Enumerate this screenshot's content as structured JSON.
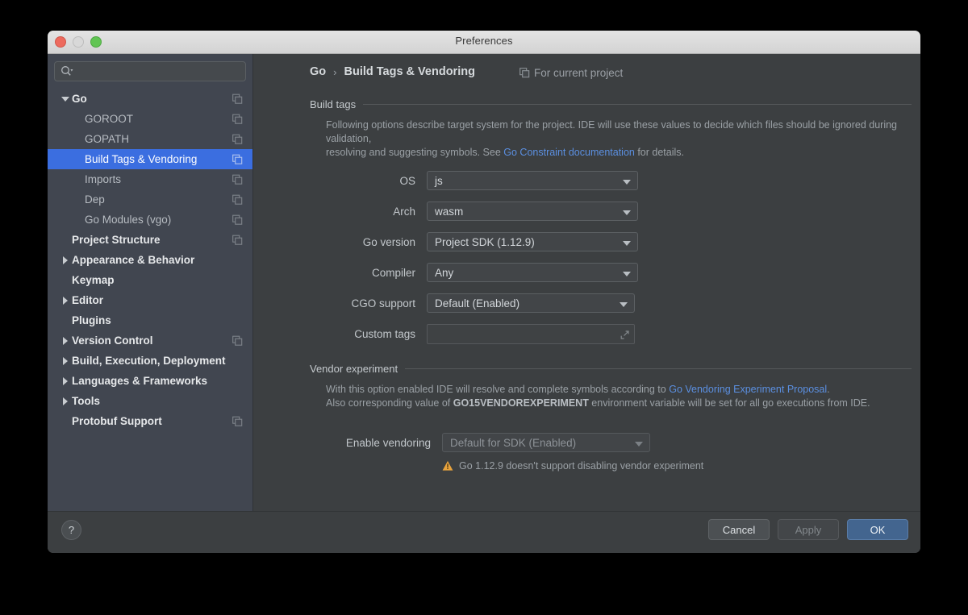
{
  "window": {
    "title": "Preferences",
    "traffic_lights": [
      "close-light",
      "minimize-light",
      "zoom-light"
    ]
  },
  "sidebar": {
    "search": {
      "placeholder": "",
      "value": "",
      "icon": "search-icon"
    },
    "items": [
      {
        "label": "Go",
        "level": "top",
        "twisty": "down",
        "copy": true,
        "selected": false
      },
      {
        "label": "GOROOT",
        "level": "child",
        "twisty": "none",
        "copy": true,
        "selected": false
      },
      {
        "label": "GOPATH",
        "level": "child",
        "twisty": "none",
        "copy": true,
        "selected": false
      },
      {
        "label": "Build Tags & Vendoring",
        "level": "child",
        "twisty": "none",
        "copy": true,
        "selected": true
      },
      {
        "label": "Imports",
        "level": "child",
        "twisty": "none",
        "copy": true,
        "selected": false
      },
      {
        "label": "Dep",
        "level": "child",
        "twisty": "none",
        "copy": true,
        "selected": false
      },
      {
        "label": "Go Modules (vgo)",
        "level": "child",
        "twisty": "none",
        "copy": true,
        "selected": false
      },
      {
        "label": "Project Structure",
        "level": "top",
        "twisty": "none",
        "copy": true,
        "selected": false
      },
      {
        "label": "Appearance & Behavior",
        "level": "top",
        "twisty": "right",
        "copy": false,
        "selected": false
      },
      {
        "label": "Keymap",
        "level": "top",
        "twisty": "none",
        "copy": false,
        "selected": false
      },
      {
        "label": "Editor",
        "level": "top",
        "twisty": "right",
        "copy": false,
        "selected": false
      },
      {
        "label": "Plugins",
        "level": "top",
        "twisty": "none",
        "copy": false,
        "selected": false
      },
      {
        "label": "Version Control",
        "level": "top",
        "twisty": "right",
        "copy": true,
        "selected": false
      },
      {
        "label": "Build, Execution, Deployment",
        "level": "top",
        "twisty": "right",
        "copy": false,
        "selected": false
      },
      {
        "label": "Languages & Frameworks",
        "level": "top",
        "twisty": "right",
        "copy": false,
        "selected": false
      },
      {
        "label": "Tools",
        "level": "top",
        "twisty": "right",
        "copy": false,
        "selected": false
      },
      {
        "label": "Protobuf Support",
        "level": "top",
        "twisty": "none",
        "copy": true,
        "selected": false
      }
    ]
  },
  "header": {
    "crumb_root": "Go",
    "crumb_sep": "›",
    "crumb_leaf": "Build Tags & Vendoring",
    "scope_label": "For current project",
    "scope_icon": "copy-icon"
  },
  "build_tags": {
    "section_title": "Build tags",
    "desc_line1": "Following options describe target system for the project. IDE will use these values to decide which files should be ignored during validation,",
    "desc_line2_pre": "resolving and suggesting symbols. See ",
    "desc_link": "Go Constraint documentation",
    "desc_line2_post": " for details.",
    "fields": {
      "os_label": "OS",
      "os_value": "js",
      "arch_label": "Arch",
      "arch_value": "wasm",
      "goversion_label": "Go version",
      "goversion_value": "Project SDK (1.12.9)",
      "compiler_label": "Compiler",
      "compiler_value": "Any",
      "cgo_label": "CGO support",
      "cgo_value": "Default (Enabled)",
      "customtags_label": "Custom tags",
      "customtags_value": "",
      "customtags_placeholder": ""
    }
  },
  "vendor_experiment": {
    "section_title": "Vendor experiment",
    "desc_line1_pre": "With this option enabled IDE will resolve and complete symbols according to ",
    "desc_link": "Go Vendoring Experiment Proposal",
    "desc_line1_post": ".",
    "desc_line2_pre": "Also corresponding value of ",
    "desc_line2_bold": "GO15VENDOREXPERIMENT",
    "desc_line2_post": " environment variable will be set for all go executions from IDE.",
    "enable_label": "Enable vendoring",
    "enable_value": "Default for SDK (Enabled)",
    "warning_text": "Go 1.12.9 doesn't support disabling vendor experiment",
    "warning_icon": "warning-triangle-icon"
  },
  "footer": {
    "help_label": "?",
    "cancel_label": "Cancel",
    "apply_label": "Apply",
    "ok_label": "OK"
  },
  "colors": {
    "selection_blue": "#3b6ee0",
    "link_blue": "#5b8fe0",
    "ok_button_blue": "#43658f",
    "warning_orange": "#e8a33d",
    "sidebar_bg": "#414650",
    "panel_bg": "#3c3f41"
  }
}
